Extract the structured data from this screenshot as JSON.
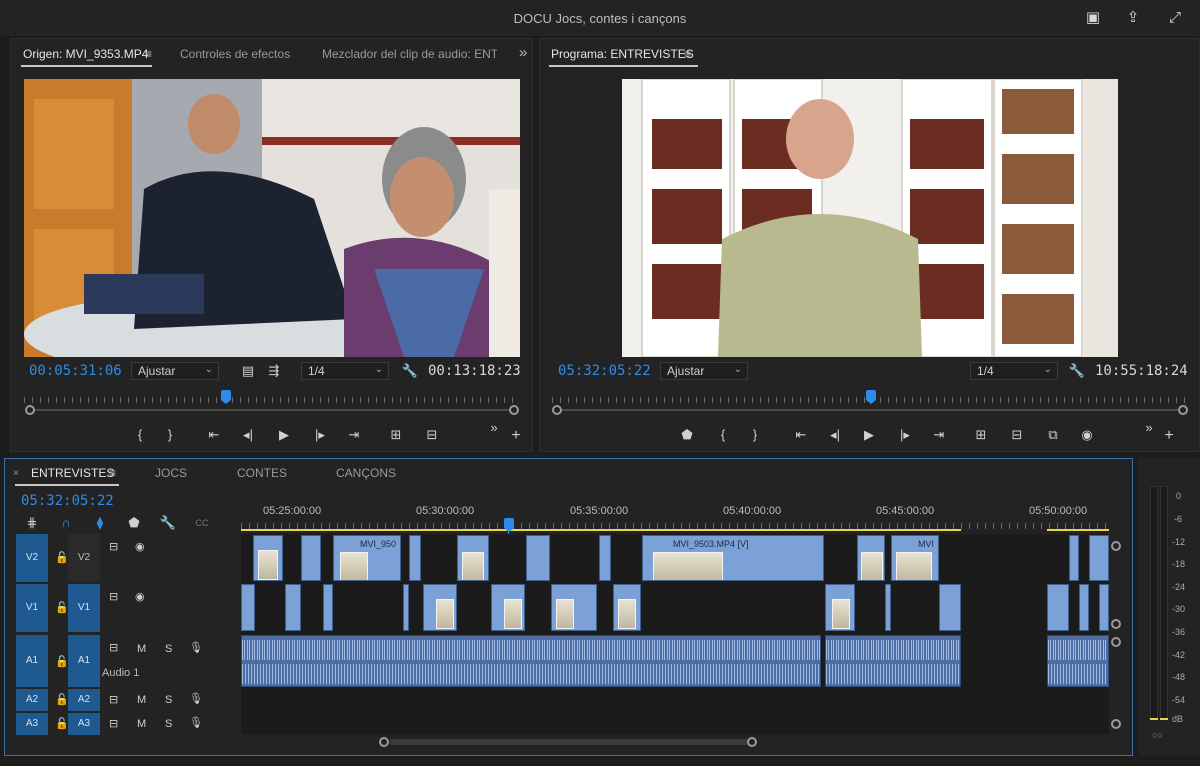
{
  "window": {
    "title": "DOCU Jocs, contes i cançons"
  },
  "source_panel": {
    "tabs": [
      "Origen: MVI_9353.MP4",
      "Controles de efectos",
      "Mezclador del clip de audio: ENTRI"
    ],
    "timecode_current": "00:05:31:06",
    "fit": "Ajustar",
    "resolution": "1/4",
    "timecode_duration": "00:13:18:23"
  },
  "program_panel": {
    "tab": "Programa: ENTREVISTES",
    "timecode_current": "05:32:05:22",
    "fit": "Ajustar",
    "resolution": "1/4",
    "timecode_duration": "10:55:18:24"
  },
  "timeline": {
    "tabs": [
      "ENTREVISTES",
      "JOCS",
      "CONTES",
      "CANÇONS"
    ],
    "timecode": "05:32:05:22",
    "ruler_labels": [
      "05:25:00:00",
      "05:30:00:00",
      "05:35:00:00",
      "05:40:00:00",
      "05:45:00:00",
      "05:50:00:00"
    ],
    "tracks": [
      {
        "id": "V2",
        "src": "V2",
        "type": "video"
      },
      {
        "id": "V1",
        "src": "V1",
        "type": "video"
      },
      {
        "id": "A1",
        "src": "A1",
        "type": "audio",
        "name": "Audio 1"
      },
      {
        "id": "A2",
        "src": "A2",
        "type": "audio"
      },
      {
        "id": "A3",
        "src": "A3",
        "type": "audio"
      }
    ],
    "clip_labels": [
      "MVI_950",
      "MVI_9503.MP4 [V]",
      "MVI"
    ],
    "mute_label": "M",
    "solo_label": "S"
  },
  "meter": {
    "labels": [
      "0",
      "-6",
      "-12",
      "-18",
      "-24",
      "-30",
      "-36",
      "-42",
      "-48",
      "-54",
      "dB"
    ]
  },
  "icons": {
    "menu": "≡",
    "overflow": "»",
    "add": "+",
    "caret": "⌄"
  }
}
